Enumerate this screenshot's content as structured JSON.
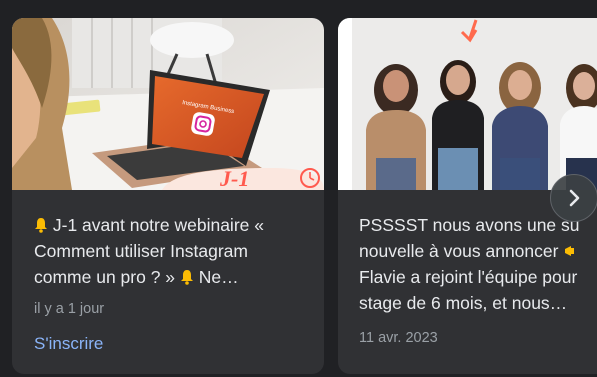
{
  "cards": [
    {
      "title_lines": [
        "J-1 avant notre webinaire «",
        "Comment utiliser Instagram",
        "comme un pro ? »",
        "Ne…"
      ],
      "image_text": {
        "screen": "Instagram Business",
        "badge": "J-1"
      },
      "meta": "il y a 1 jour",
      "action": "S'inscrire"
    },
    {
      "title_lines": [
        "PSSSST nous avons une su",
        "nouvelle à vous annoncer",
        "Flavie a rejoint l'équipe pour",
        "stage de 6 mois, et nous…"
      ],
      "meta": "11 avr. 2023"
    }
  ],
  "carousel": {
    "next_icon": "chevron-right-icon"
  },
  "colors": {
    "card_bg": "#303134",
    "page_bg": "#202124",
    "title": "#e8eaed",
    "meta": "#9aa0a6",
    "link": "#8ab4f8",
    "bell": "#fbbc04"
  }
}
